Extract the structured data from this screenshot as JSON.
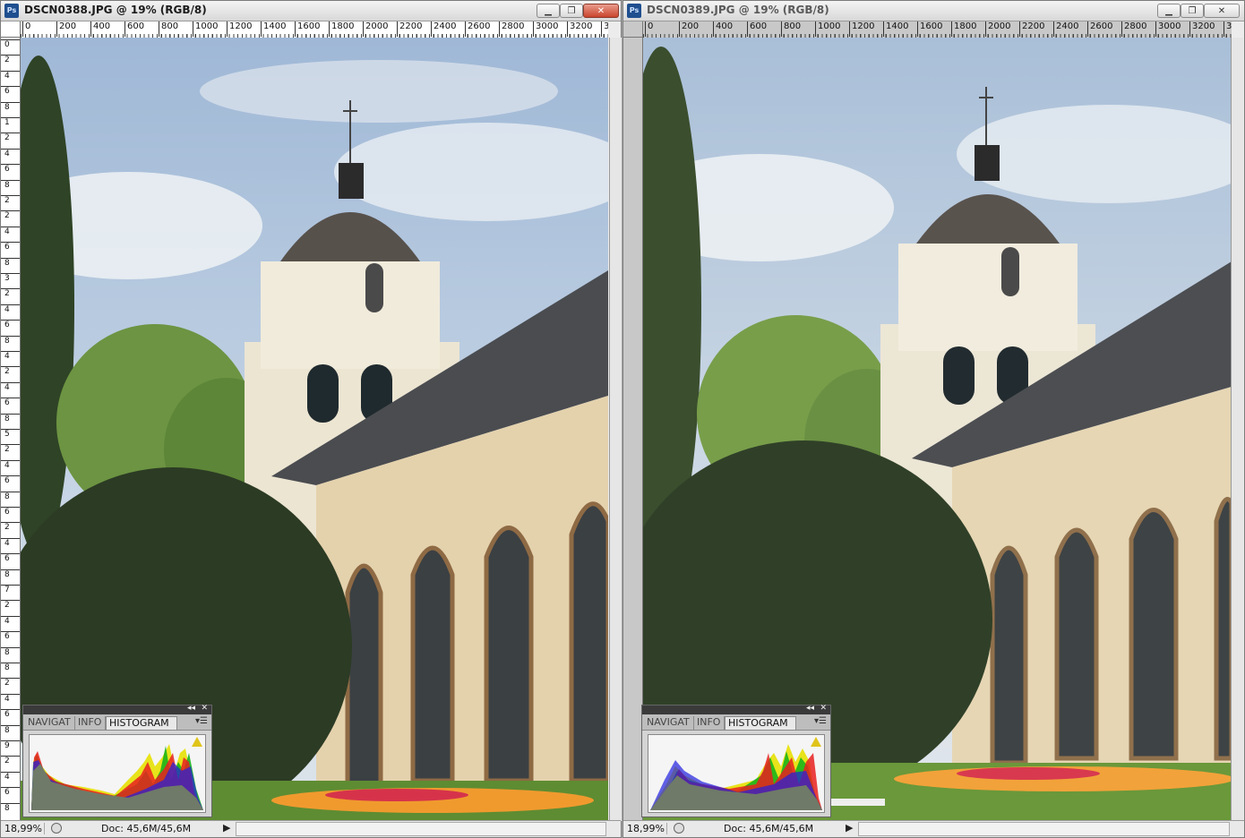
{
  "windows": [
    {
      "title": "DSCN0388.JPG @ 19% (RGB/8)",
      "ps_badge": "Ps",
      "controls": {
        "minimize": "▁",
        "restore": "❐",
        "close": "✕"
      },
      "ruler_h": [
        "0",
        "200",
        "400",
        "600",
        "800",
        "1000",
        "1200",
        "1400",
        "1600",
        "1800",
        "2000",
        "2200",
        "2400",
        "2600",
        "2800",
        "3000",
        "3200",
        "34"
      ],
      "ruler_v": [
        "0",
        "2",
        "4",
        "6",
        "8",
        "1",
        "2",
        "4",
        "6",
        "8",
        "2",
        "2",
        "4",
        "6",
        "8",
        "3",
        "2",
        "4",
        "6",
        "8",
        "4",
        "2",
        "4",
        "6",
        "8",
        "5",
        "2",
        "4",
        "6",
        "8",
        "6",
        "2",
        "4",
        "6",
        "8",
        "7",
        "2",
        "4",
        "6",
        "8",
        "8",
        "2",
        "4",
        "6",
        "8",
        "9",
        "2",
        "4",
        "6",
        "8"
      ],
      "status": {
        "zoom": "18,99%",
        "doc": "Doc: 45,6M/45,6M",
        "arrow": "▶"
      },
      "panel": {
        "tabs": [
          "NAVIGAT",
          "INFO",
          "HISTOGRAM"
        ],
        "active_tab": "HISTOGRAM",
        "collapse": "◂◂",
        "close": "✕",
        "menu": "▾☰"
      }
    },
    {
      "title": "DSCN0389.JPG @ 19% (RGB/8)",
      "ps_badge": "Ps",
      "controls": {
        "minimize": "▁",
        "restore": "❐",
        "close": "✕"
      },
      "ruler_h": [
        "0",
        "200",
        "400",
        "600",
        "800",
        "1000",
        "1200",
        "1400",
        "1600",
        "1800",
        "2000",
        "2200",
        "2400",
        "2600",
        "2800",
        "3000",
        "3200",
        "34"
      ],
      "ruler_v": [],
      "status": {
        "zoom": "18,99%",
        "doc": "Doc: 45,6M/45,6M",
        "arrow": "▶"
      },
      "panel": {
        "tabs": [
          "NAVIGAT",
          "INFO",
          "HISTOGRAM"
        ],
        "active_tab": "HISTOGRAM",
        "collapse": "◂◂",
        "close": "✕",
        "menu": "▾☰"
      }
    }
  ],
  "colors": {
    "sky": "#b9cde3",
    "cloud": "#e9eef3",
    "facade": "#e6d4b0",
    "roof": "#4a4c50",
    "dome": "#55504c",
    "tower": "#efe9d8",
    "foliage_dark": "#2d3b24",
    "foliage_light": "#6f963f",
    "lawn": "#5e8c32",
    "histo_gray": "#6f7a68"
  }
}
